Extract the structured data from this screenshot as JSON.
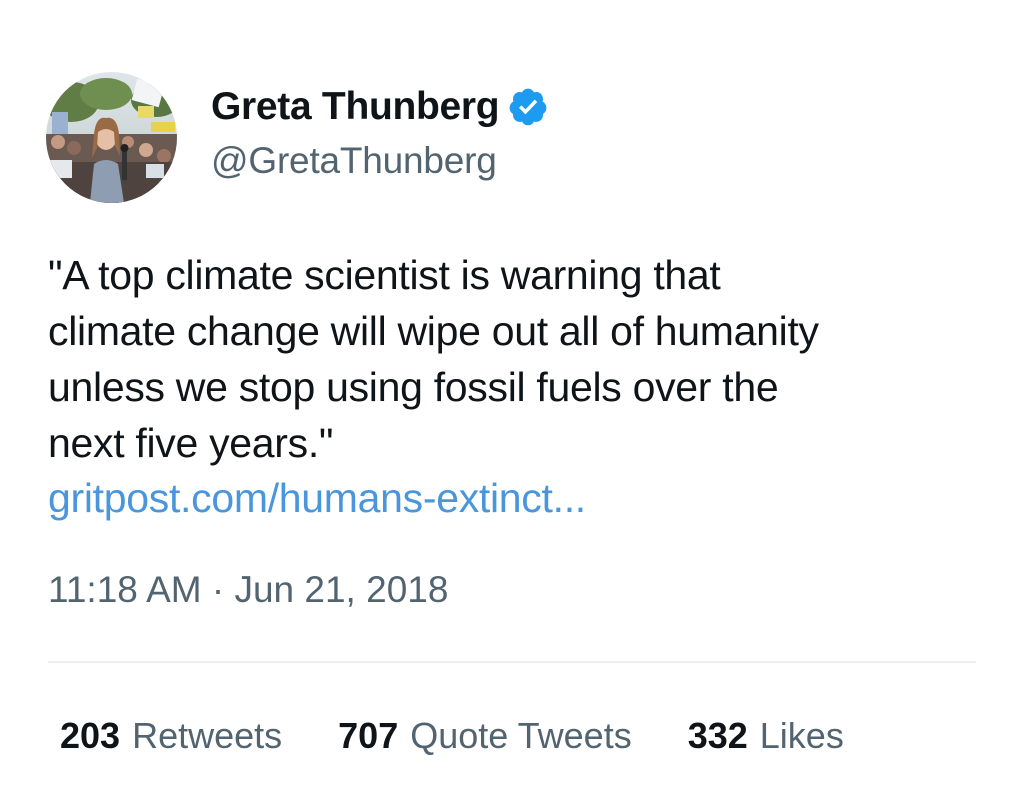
{
  "author": {
    "display_name": "Greta Thunberg",
    "handle": "@GretaThunberg",
    "verified_icon": "verified-badge-icon",
    "avatar": "profile-photo"
  },
  "tweet": {
    "text_lines": [
      "\"A top climate scientist is warning that",
      "climate change will wipe out all of humanity",
      "unless we stop using fossil fuels over the",
      "next five years.\""
    ],
    "link_text": "gritpost.com/humans-extinct...",
    "timestamp": "11:18 AM · Jun 21, 2018"
  },
  "stats": {
    "retweets": {
      "count": "203",
      "label": "Retweets"
    },
    "quote_tweets": {
      "count": "707",
      "label": "Quote Tweets"
    },
    "likes": {
      "count": "332",
      "label": "Likes"
    }
  },
  "colors": {
    "link": "#4a96dd",
    "verified": "#1d9bf0",
    "secondary_text": "#536471",
    "primary_text": "#0f1419",
    "divider": "#eceff1"
  }
}
